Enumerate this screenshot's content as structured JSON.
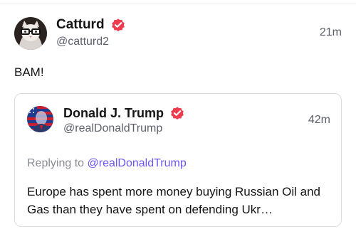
{
  "colors": {
    "verified_badge": "#ef3b4e",
    "mention": "#6b56f5",
    "text_primary": "#141416",
    "text_secondary": "#5d5f6b",
    "border": "#dcdde3"
  },
  "post": {
    "author_name": "Catturd",
    "author_handle": "@catturd2",
    "timestamp": "21m",
    "text": "BAM!",
    "avatar_icon": "cat-avatar-icon",
    "verified_icon": "verified-badge-icon"
  },
  "quoted_post": {
    "author_name": "Donald J. Trump",
    "author_handle": "@realDonaldTrump",
    "timestamp": "42m",
    "replying_prefix": "Replying to",
    "replying_mention": "@realDonaldTrump",
    "text": "Europe has spent more money buying Russian Oil and Gas than they have spent on defending Ukr…",
    "avatar_icon": "flag-portrait-avatar-icon",
    "verified_icon": "verified-badge-icon"
  }
}
